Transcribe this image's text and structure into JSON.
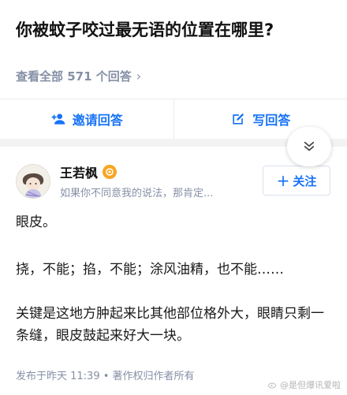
{
  "question": {
    "title": "你被蚊子咬过最无语的位置在哪里?",
    "answers_meta": "查看全部 571 个回答"
  },
  "actions": {
    "invite_label": "邀请回答",
    "write_label": "写回答"
  },
  "author": {
    "name": "王若枫",
    "signature": "如果你不同意我的说法，那肯定...",
    "follow_label": "关注"
  },
  "answer": {
    "paragraphs": [
      "眼皮。",
      "挠，不能；掐，不能；涂风油精，也不能……",
      "关键是这地方肿起来比其他部位格外大，眼睛只剩一条缝，眼皮鼓起来好大一块。"
    ]
  },
  "footer": {
    "meta": "发布于昨天 11:39 • 著作权归作者所有"
  },
  "watermark": "@是但爆讯爱啦",
  "colors": {
    "accent": "#1772f6",
    "muted": "#8590a6",
    "badge": "#f6a623"
  }
}
